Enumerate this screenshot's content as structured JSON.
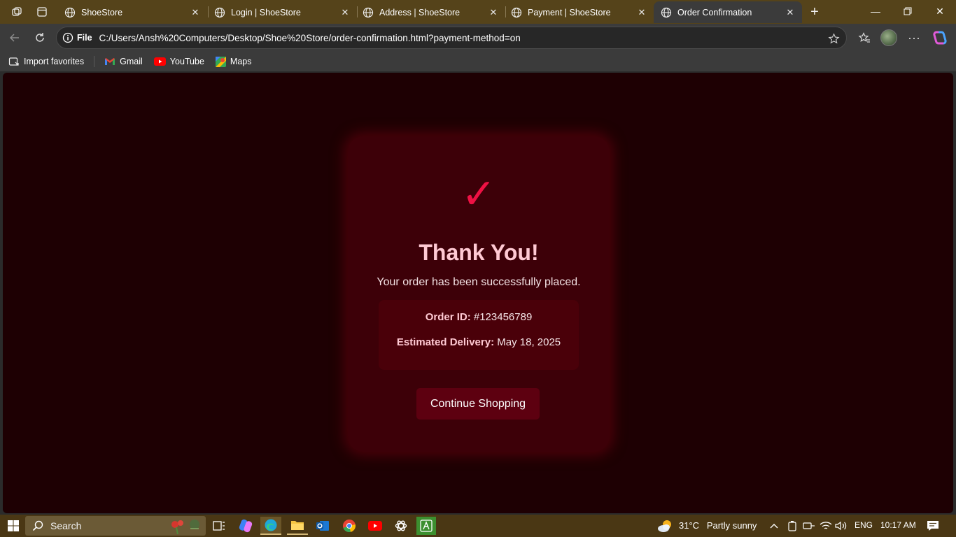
{
  "browser": {
    "tabs": [
      {
        "title": "ShoeStore",
        "active": false
      },
      {
        "title": "Login | ShoeStore",
        "active": false
      },
      {
        "title": "Address | ShoeStore",
        "active": false
      },
      {
        "title": "Payment | ShoeStore",
        "active": false
      },
      {
        "title": "Order Confirmation",
        "active": true
      }
    ],
    "address": {
      "scheme_label": "File",
      "url": "C:/Users/Ansh%20Computers/Desktop/Shoe%20Store/order-confirmation.html?payment-method=on"
    },
    "favorites": [
      {
        "label": "Import favorites",
        "icon": "import-icon"
      },
      {
        "label": "Gmail",
        "icon": "gmail-icon"
      },
      {
        "label": "YouTube",
        "icon": "youtube-icon"
      },
      {
        "label": "Maps",
        "icon": "maps-icon"
      }
    ]
  },
  "page": {
    "check_mark": "✓",
    "heading": "Thank You!",
    "subtext": "Your order has been successfully placed.",
    "order": {
      "id_label": "Order ID:",
      "id_value": "#123456789",
      "delivery_label": "Estimated Delivery:",
      "delivery_value": "May 18, 2025"
    },
    "cta_label": "Continue Shopping",
    "colors": {
      "background": "#1e0003",
      "card": "#3d0008",
      "accent": "#ee1144",
      "heading": "#ffc9d3",
      "button": "#5d0010"
    }
  },
  "taskbar": {
    "search_label": "Search",
    "weather": {
      "temp": "31°C",
      "condition": "Partly sunny"
    },
    "language": "ENG",
    "time": "10:17 AM"
  }
}
